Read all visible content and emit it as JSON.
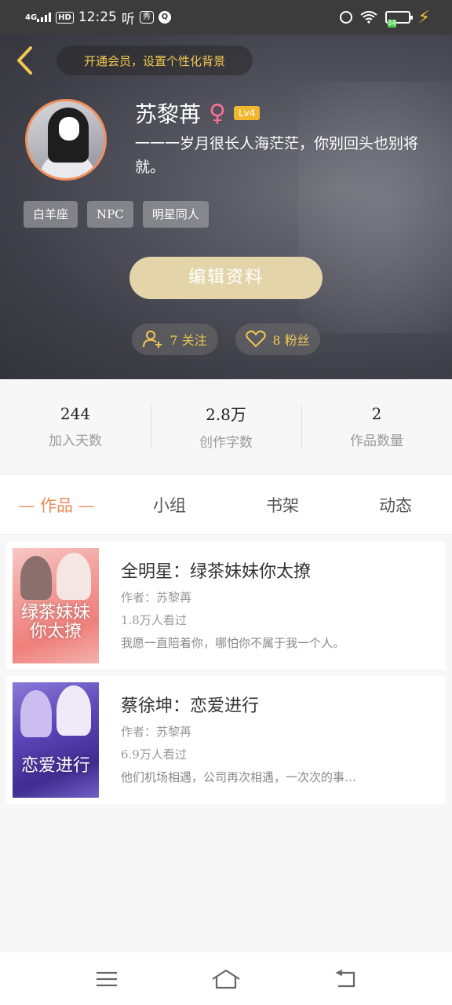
{
  "status_bar": {
    "network": "4G",
    "hd": "HD",
    "time": "12:25",
    "extra1": "听",
    "extra2": "秀",
    "battery_text": "34",
    "battery_level": 0.34
  },
  "header": {
    "vip_prompt": "开通会员，设置个性化背景",
    "username": "苏黎苒",
    "gender_symbol": "♀",
    "level": "Lv4",
    "bio": "一一一岁月很长人海茫茫，你别回头也别将就。",
    "tags": [
      "白羊座",
      "NPC",
      "明星同人"
    ],
    "edit_button": "编辑资料",
    "following": "7 关注",
    "fans": "8 粉丝"
  },
  "stats": [
    {
      "value": "244",
      "label": "加入天数"
    },
    {
      "value": "2.8万",
      "label": "创作字数"
    },
    {
      "value": "2",
      "label": "作品数量"
    }
  ],
  "tabs": [
    {
      "label": "作品",
      "active": true
    },
    {
      "label": "小组",
      "active": false
    },
    {
      "label": "书架",
      "active": false
    },
    {
      "label": "动态",
      "active": false
    }
  ],
  "works": [
    {
      "title": "全明星：绿茶妹妹你太撩",
      "author": "作者：苏黎苒",
      "views": "1.8万人看过",
      "desc": "我愿一直陪着你，哪怕你不属于我一个人。",
      "cover_text": "绿茶妹妹你太撩",
      "cover_color": "#f29a95"
    },
    {
      "title": "蔡徐坤：恋爱进行",
      "author": "作者：苏黎苒",
      "views": "6.9万人看过",
      "desc": "他们机场相遇，公司再次相遇，一次次的事…",
      "cover_text": "恋爱进行",
      "cover_color": "#5b45b8"
    }
  ],
  "icons": {
    "back": "chevron-left-icon",
    "menu": "menu-icon",
    "home": "home-icon",
    "return": "return-icon"
  },
  "colors": {
    "accent": "#e98b5c",
    "gold": "#f0c850",
    "level_badge": "#f2b731",
    "edit_button": "#e3d4a9"
  }
}
